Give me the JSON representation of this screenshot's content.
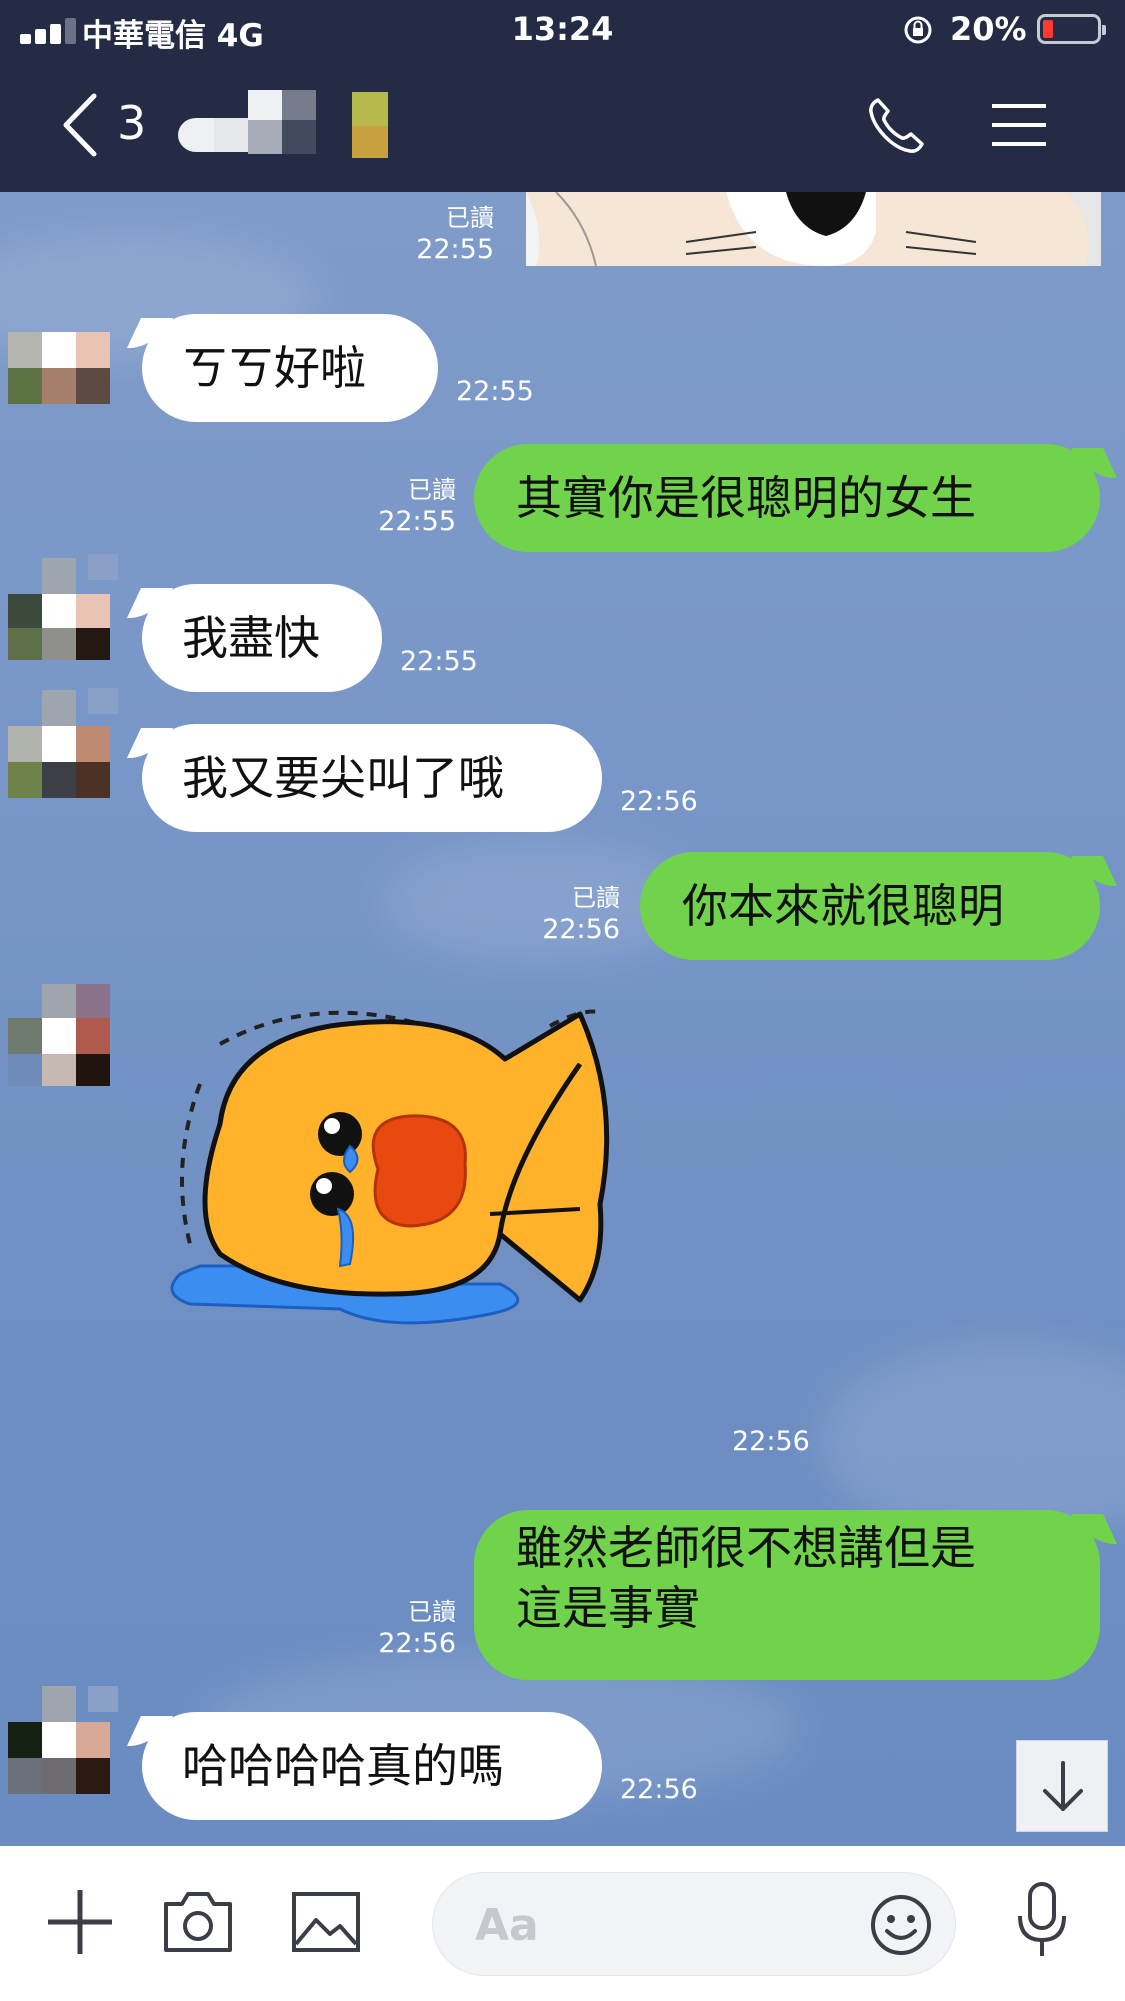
{
  "status_bar": {
    "carrier": "中華電信 4G",
    "time": "13:24",
    "battery_percent": "20%",
    "battery_level": 0.2,
    "signal_bars": 3
  },
  "header": {
    "unread_count": "3"
  },
  "messages": [
    {
      "side": "in",
      "text": "ㄎㄎ好啦",
      "time": "22:55"
    },
    {
      "side": "out",
      "text": "其實你是很聰明的女生",
      "read": "已讀",
      "time": "22:55"
    },
    {
      "side": "in",
      "text": "我盡快",
      "time": "22:55"
    },
    {
      "side": "in",
      "text": "我又要尖叫了哦",
      "time": "22:56"
    },
    {
      "side": "out",
      "text": "你本來就很聰明",
      "read": "已讀",
      "time": "22:56"
    },
    {
      "side": "in",
      "type": "sticker",
      "time": "22:56"
    },
    {
      "side": "out",
      "lines": [
        "雖然老師很不想講但是",
        "這是事實"
      ],
      "read": "已讀",
      "time": "22:56"
    },
    {
      "side": "in",
      "text": "哈哈哈哈真的嗎",
      "time": "22:56"
    }
  ],
  "top_partial": {
    "read": "已讀",
    "time": "22:55"
  },
  "input": {
    "placeholder": "Aa"
  },
  "colors": {
    "header_bg": "#232b45",
    "chat_bg": "#7896c7",
    "outgoing_bubble": "#71d34b",
    "incoming_bubble": "#ffffff"
  },
  "icons": [
    "back-icon",
    "call-icon",
    "menu-icon",
    "plus-icon",
    "camera-icon",
    "image-icon",
    "emoji-icon",
    "microphone-icon",
    "arrow-down-icon"
  ]
}
